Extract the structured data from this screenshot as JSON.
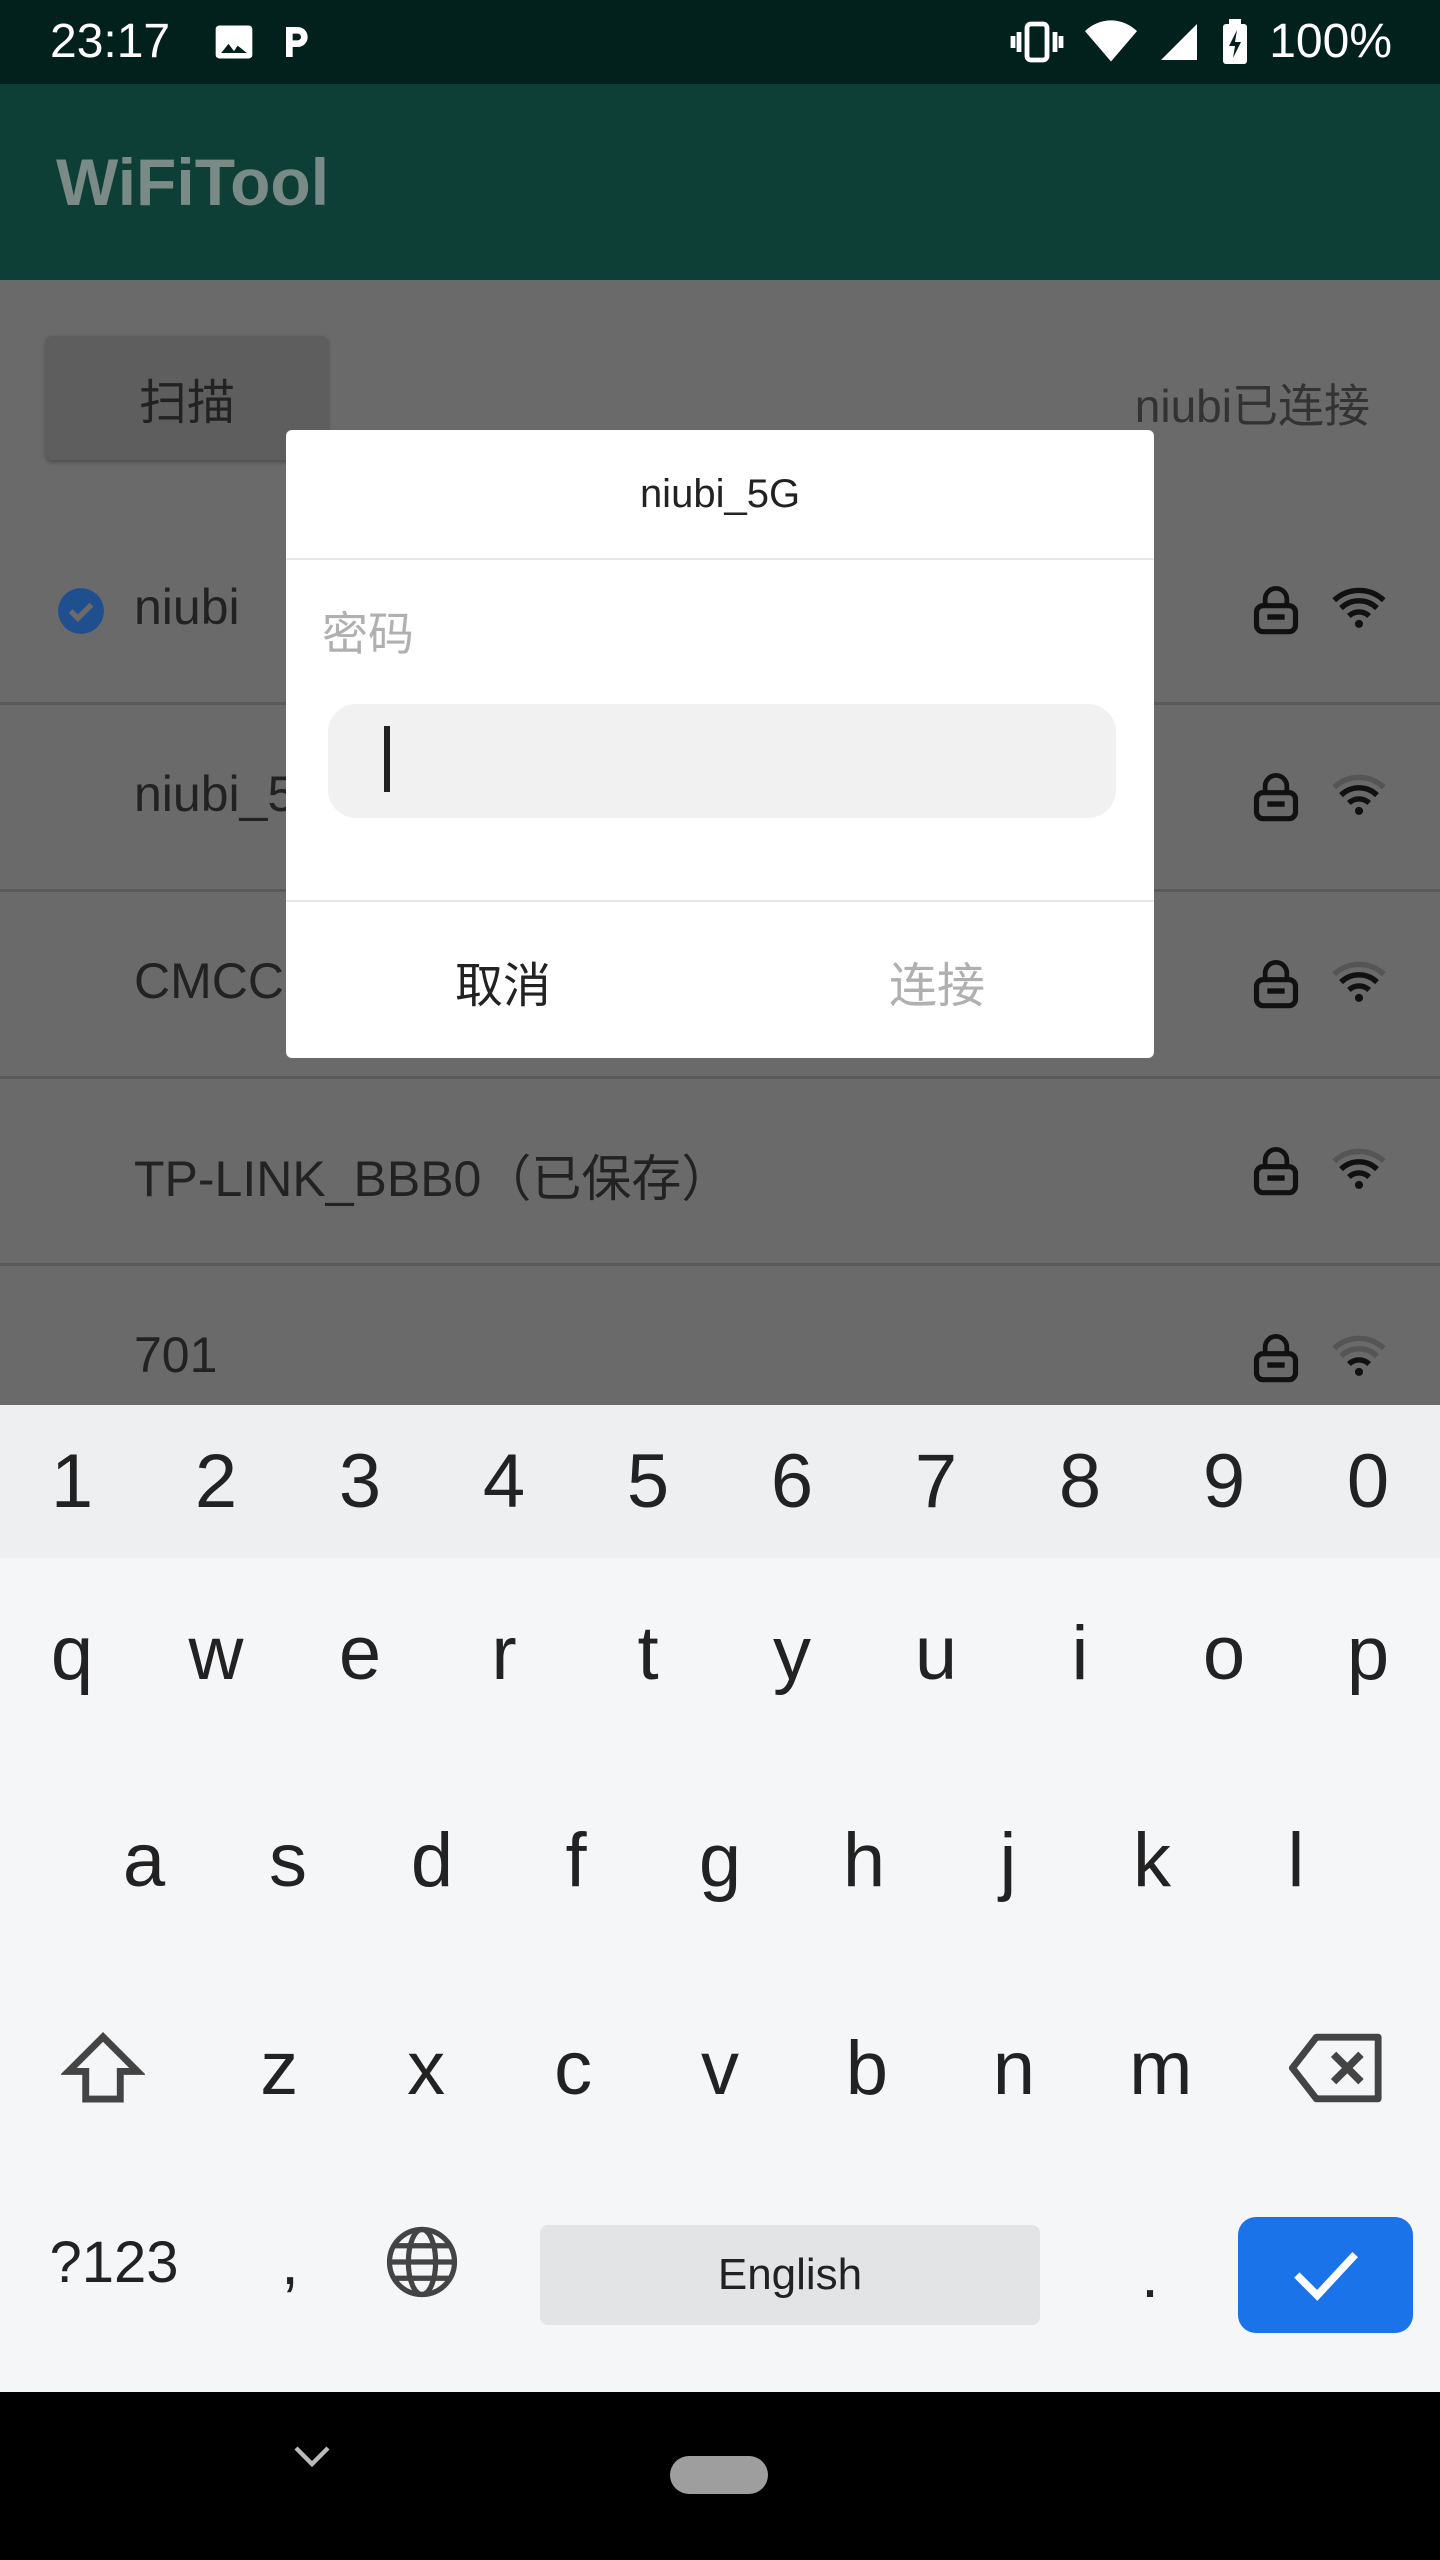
{
  "status_bar": {
    "time": "23:17",
    "battery": "100%"
  },
  "app": {
    "title": "WiFiTool"
  },
  "main": {
    "scan_label": "扫描",
    "connection_status": "niubi已连接",
    "networks": [
      {
        "name": "niubi",
        "connected": true
      },
      {
        "name": "niubi_5"
      },
      {
        "name": "CMCC"
      },
      {
        "name": "TP-LINK_BBB0（已保存）"
      },
      {
        "name": "701"
      }
    ]
  },
  "dialog": {
    "title": "niubi_5G",
    "password_label": "密码",
    "password_value": "",
    "cancel_label": "取消",
    "connect_label": "连接"
  },
  "keyboard": {
    "numbers": [
      "1",
      "2",
      "3",
      "4",
      "5",
      "6",
      "7",
      "8",
      "9",
      "0"
    ],
    "row1": [
      "q",
      "w",
      "e",
      "r",
      "t",
      "y",
      "u",
      "i",
      "o",
      "p"
    ],
    "row2": [
      "a",
      "s",
      "d",
      "f",
      "g",
      "h",
      "j",
      "k",
      "l"
    ],
    "row3": [
      "z",
      "x",
      "c",
      "v",
      "b",
      "n",
      "m"
    ],
    "symbols_label": "?123",
    "comma_label": ",",
    "space_label": "English",
    "period_label": "."
  },
  "colors": {
    "accent": "#1a73e8",
    "app_bar": "#0e3f37",
    "status_bar": "#02201c"
  }
}
